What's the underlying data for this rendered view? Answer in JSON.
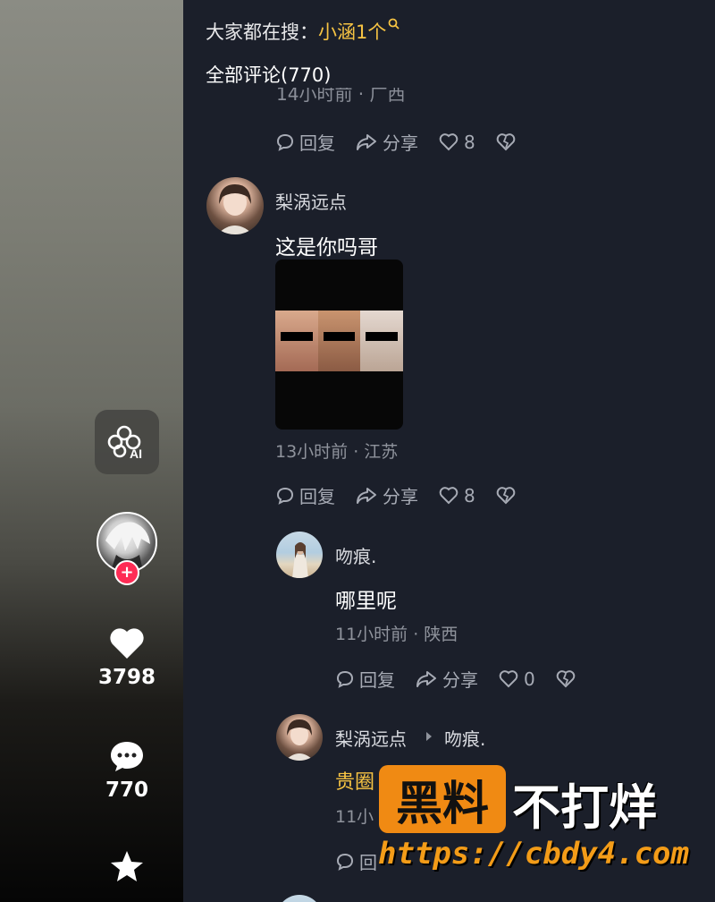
{
  "search": {
    "prefix": "大家都在搜：",
    "keyword": "小涵1个"
  },
  "comments_title": "全部评论(770)",
  "cut_text": "14小时前 · 广西",
  "actions": {
    "reply": "回复",
    "share": "分享"
  },
  "comments": [
    {
      "likes_prev": "8"
    },
    {
      "username": "梨涡远点",
      "content": "这是你吗哥",
      "meta": "13小时前 · 江苏",
      "likes": "8"
    },
    {
      "username": "吻痕.",
      "content": "哪里呢",
      "meta": "11小时前 · 陕西",
      "likes": "0"
    },
    {
      "username": "梨涡远点",
      "reply_to": "吻痕.",
      "content_partial": "贵圈",
      "meta_partial": "11小",
      "reply_partial": "回"
    }
  ],
  "sidebar": {
    "likes_count": "3798",
    "comments_count": "770",
    "ai_label": "AI"
  },
  "watermark": {
    "badge": "黑料",
    "text": "不打烊",
    "url": "https://cbdy4.com"
  },
  "colors": {
    "panel_bg": "#1b1f2a",
    "keyword": "#f6c343",
    "follow": "#fe2c55",
    "watermark_orange": "#f08a13"
  }
}
